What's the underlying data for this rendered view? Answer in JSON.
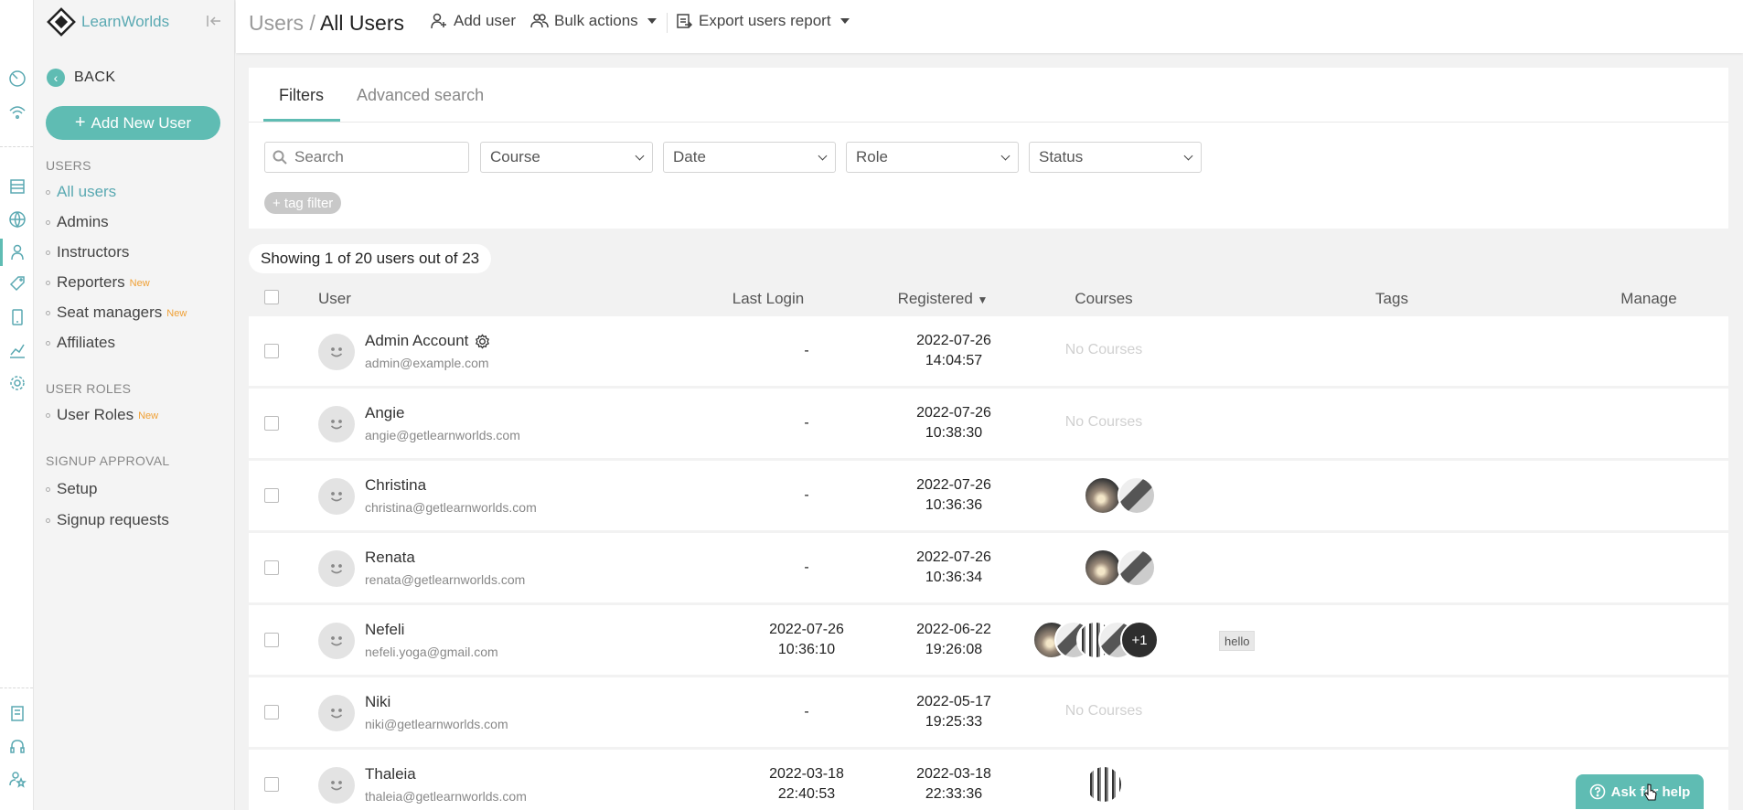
{
  "app": {
    "name": "LearnWorlds"
  },
  "sidebar": {
    "back_label": "BACK",
    "add_user_label": "Add New User",
    "sections": [
      {
        "heading": "USERS",
        "items": [
          {
            "label": "All users",
            "badge": "",
            "active": true
          },
          {
            "label": "Admins",
            "badge": ""
          },
          {
            "label": "Instructors",
            "badge": ""
          },
          {
            "label": "Reporters",
            "badge": "New"
          },
          {
            "label": "Seat managers",
            "badge": "New"
          },
          {
            "label": "Affiliates",
            "badge": ""
          }
        ]
      },
      {
        "heading": "USER ROLES",
        "items": [
          {
            "label": "User Roles",
            "badge": "New"
          }
        ]
      },
      {
        "heading": "SIGNUP APPROVAL",
        "items": [
          {
            "label": "Setup",
            "badge": ""
          },
          {
            "label": "Signup requests",
            "badge": ""
          }
        ]
      }
    ]
  },
  "header": {
    "crumb_parent": "Users /",
    "crumb_current": "All Users",
    "add_user": "Add user",
    "bulk_actions": "Bulk actions",
    "export": "Export users report"
  },
  "filters": {
    "tab_filters": "Filters",
    "tab_advanced": "Advanced search",
    "search_placeholder": "Search",
    "course": "Course",
    "date": "Date",
    "role": "Role",
    "status": "Status",
    "tag_filter": "+ tag filter"
  },
  "summary": "Showing 1 of 20 users out of 23",
  "table": {
    "columns": {
      "user": "User",
      "last_login": "Last Login",
      "registered": "Registered",
      "courses": "Courses",
      "tags": "Tags",
      "manage": "Manage"
    },
    "no_courses": "No Courses",
    "rows": [
      {
        "name": "Admin Account",
        "email": "admin@example.com",
        "last_login": [
          "-"
        ],
        "registered": [
          "2022-07-26",
          "14:04:57"
        ],
        "courses": 0,
        "plus": "",
        "tag": "",
        "admin_icon": true
      },
      {
        "name": "Angie",
        "email": "angie@getlearnworlds.com",
        "last_login": [
          "-"
        ],
        "registered": [
          "2022-07-26",
          "10:38:30"
        ],
        "courses": 0,
        "plus": "",
        "tag": ""
      },
      {
        "name": "Christina",
        "email": "christina@getlearnworlds.com",
        "last_login": [
          "-"
        ],
        "registered": [
          "2022-07-26",
          "10:36:36"
        ],
        "courses": 2,
        "plus": "",
        "tag": ""
      },
      {
        "name": "Renata",
        "email": "renata@getlearnworlds.com",
        "last_login": [
          "-"
        ],
        "registered": [
          "2022-07-26",
          "10:36:34"
        ],
        "courses": 2,
        "plus": "",
        "tag": ""
      },
      {
        "name": "Nefeli",
        "email": "nefeli.yoga@gmail.com",
        "last_login": [
          "2022-07-26",
          "10:36:10"
        ],
        "registered": [
          "2022-06-22",
          "19:26:08"
        ],
        "courses": 4,
        "plus": "+1",
        "tag": "hello"
      },
      {
        "name": "Niki",
        "email": "niki@getlearnworlds.com",
        "last_login": [
          "-"
        ],
        "registered": [
          "2022-05-17",
          "19:25:33"
        ],
        "courses": 0,
        "plus": "",
        "tag": ""
      },
      {
        "name": "Thaleia",
        "email": "thaleia@getlearnworlds.com",
        "last_login": [
          "2022-03-18",
          "22:40:53"
        ],
        "registered": [
          "2022-03-18",
          "22:33:36"
        ],
        "courses": 1,
        "plus": "",
        "tag": ""
      }
    ]
  },
  "help_label": "Ask for help",
  "colors": {
    "accent": "#5fbcb3",
    "new_badge": "#f0a035"
  }
}
